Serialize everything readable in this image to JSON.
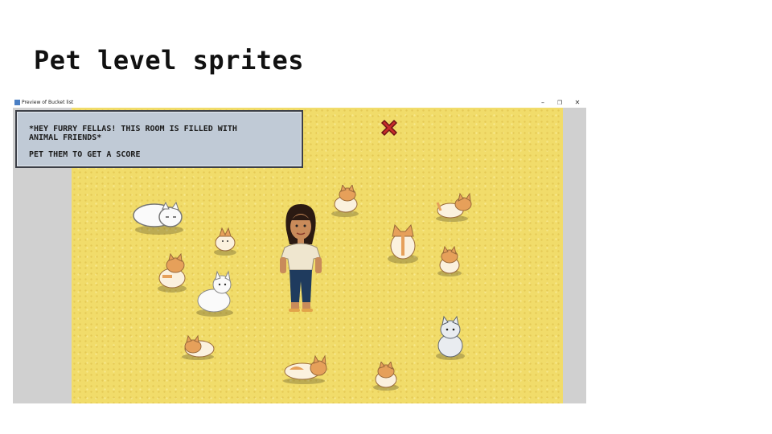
{
  "slide": {
    "title": "Pet level sprites"
  },
  "window": {
    "title": "Preview of Bucket list",
    "controls": {
      "minimize": "–",
      "maximize": "❐",
      "close": "✕"
    }
  },
  "dialog": {
    "line1": "*HEY FURRY FELLAS! THIS ROOM IS FILLED WITH",
    "line2": "ANIMAL FRIENDS*",
    "line3": "PET THEM TO GET A SCORE"
  },
  "game": {
    "close_icon": "red-x-icon",
    "colors": {
      "sand": "#f1dc6a",
      "dialog_bg": "#c0cad6",
      "close_x": "#c62c2c",
      "cat_orange": "#e6a05a",
      "cat_cream": "#fbf1de"
    },
    "sprites": [
      {
        "name": "white-cat-lying",
        "kind": "white-cat-lying"
      },
      {
        "name": "orange-cat-sitting",
        "kind": "orange-cat-sitting"
      },
      {
        "name": "orange-cat-licking",
        "kind": "orange-cat-licking"
      },
      {
        "name": "white-dog-sitting",
        "kind": "white-dog-sitting"
      },
      {
        "name": "orange-cat-loaf",
        "kind": "orange-cat-loaf"
      },
      {
        "name": "orange-cat-lying",
        "kind": "orange-cat-lying"
      },
      {
        "name": "orange-cat-scratching",
        "kind": "orange-cat-scratching"
      },
      {
        "name": "orange-cat-standing",
        "kind": "orange-cat-standing"
      },
      {
        "name": "orange-cat-back",
        "kind": "orange-cat-back"
      },
      {
        "name": "orange-cat-small",
        "kind": "orange-cat-small"
      },
      {
        "name": "orange-cat-sitting-2",
        "kind": "orange-cat-sitting"
      },
      {
        "name": "gray-dog-sitting",
        "kind": "gray-dog-sitting"
      }
    ]
  }
}
